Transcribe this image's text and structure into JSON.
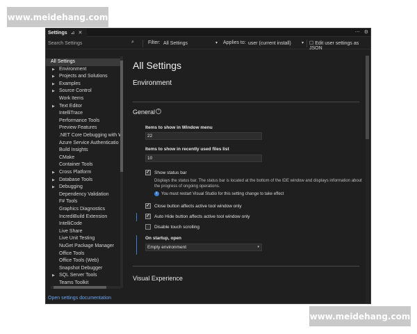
{
  "watermark": {
    "top_left": "www.meidehang.com",
    "bottom_right": "www.meidehang.com"
  },
  "tab": {
    "title": "Settings",
    "pin_icon": "⊿",
    "close_icon": "✕"
  },
  "tab_actions": {
    "menu_icon": "⋯",
    "gear_icon": "⚙"
  },
  "toolbar": {
    "search_placeholder": "Search Settings",
    "search_icon": "⌕",
    "filter_label": "Filter:",
    "filter_value": "All Settings",
    "applies_label": "Applies to:",
    "applies_value": "user (current install)",
    "edit_json_label": "Edit user settings as JSON",
    "edit_json_icon": "☐"
  },
  "sidebar": {
    "items": [
      {
        "label": "All Settings",
        "expandable": false,
        "selected": true
      },
      {
        "label": "Environment",
        "expandable": true
      },
      {
        "label": "Projects and Solutions",
        "expandable": true
      },
      {
        "label": "Examples",
        "expandable": true
      },
      {
        "label": "Source Control",
        "expandable": true
      },
      {
        "label": "Work Items",
        "expandable": false
      },
      {
        "label": "Text Editor",
        "expandable": true
      },
      {
        "label": "IntelliTrace",
        "expandable": false
      },
      {
        "label": "Performance Tools",
        "expandable": false
      },
      {
        "label": "Preview Features",
        "expandable": false
      },
      {
        "label": ".NET Core Debugging with W",
        "expandable": false
      },
      {
        "label": "Azure Service Authenticatio",
        "expandable": false
      },
      {
        "label": "Build Insights",
        "expandable": false
      },
      {
        "label": "CMake",
        "expandable": false
      },
      {
        "label": "Container Tools",
        "expandable": false
      },
      {
        "label": "Cross Platform",
        "expandable": true
      },
      {
        "label": "Database Tools",
        "expandable": true
      },
      {
        "label": "Debugging",
        "expandable": true
      },
      {
        "label": "Dependency Validation",
        "expandable": false
      },
      {
        "label": "F# Tools",
        "expandable": false
      },
      {
        "label": "Graphics Diagnostics",
        "expandable": false
      },
      {
        "label": "IncrediBuild Extension",
        "expandable": false
      },
      {
        "label": "IntelliCode",
        "expandable": false
      },
      {
        "label": "Live Share",
        "expandable": false
      },
      {
        "label": "Live Unit Testing",
        "expandable": false
      },
      {
        "label": "NuGet Package Manager",
        "expandable": false
      },
      {
        "label": "Office Tools",
        "expandable": false
      },
      {
        "label": "Office Tools (Web)",
        "expandable": false
      },
      {
        "label": "Snapshot Debugger",
        "expandable": false
      },
      {
        "label": "SQL Server Tools",
        "expandable": true
      },
      {
        "label": "Teams Toolkit",
        "expandable": false
      }
    ],
    "open_docs_link": "Open settings documentation"
  },
  "main": {
    "title": "All Settings",
    "section_environment": "Environment",
    "section_general": "General",
    "help_icon": "?",
    "items_window_menu_label": "Items to show in Window menu",
    "items_window_menu_value": "22",
    "items_recent_files_label": "Items to show in recently used files list",
    "items_recent_files_value": "10",
    "show_status_bar_label": "Show status bar",
    "show_status_bar_checked": true,
    "show_status_bar_desc": "Displays the status bar. The status bar is located at the bottom of the IDE window and displays information about the progress of ongoing operations.",
    "restart_notice": "You must restart Visual Studio for this setting change to take effect",
    "close_button_label": "Close button affects active tool window only",
    "close_button_checked": true,
    "auto_hide_label": "Auto Hide button affects active tool window only",
    "auto_hide_checked": true,
    "disable_touch_label": "Disable touch scrolling",
    "disable_touch_checked": false,
    "startup_label": "On startup, open",
    "startup_value": "Empty environment",
    "section_visual": "Visual Experience"
  }
}
